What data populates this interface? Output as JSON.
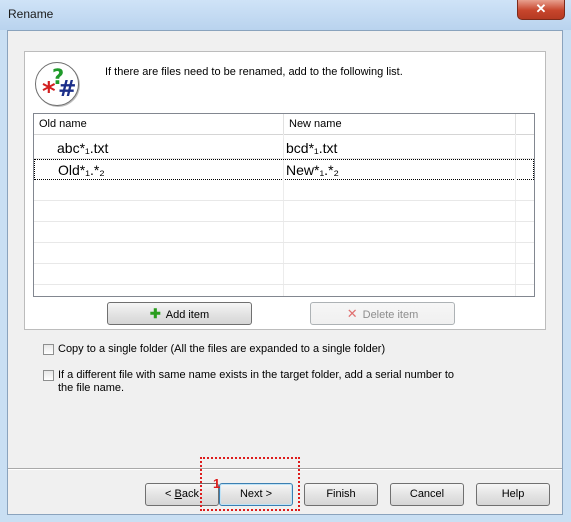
{
  "window": {
    "title": "Rename",
    "close_label": "✕"
  },
  "intro_text": "If there are files need to be renamed, add to the following list.",
  "list": {
    "columns": [
      "Old name",
      "New name"
    ],
    "rows": [
      {
        "old": "abc*₁.txt",
        "new": "bcd*₁.txt"
      },
      {
        "old": "Old*₁.*₂",
        "new": "New*₁.*₂"
      }
    ]
  },
  "buttons": {
    "add_item": "Add item",
    "delete_item": "Delete item",
    "back_prefix": "< ",
    "back_mnemonic": "B",
    "back_rest": "ack",
    "next": "Next >",
    "finish": "Finish",
    "cancel": "Cancel",
    "help": "Help"
  },
  "options": {
    "copy_single_folder": "Copy to a single folder (All the files are expanded to a single folder)",
    "serial_number_line1": "If a different file with same name exists in the target folder, add a serial number to",
    "serial_number_line2": "the file name."
  },
  "annotation": {
    "number": "1"
  },
  "colors": {
    "focus_box": "#dd1c1c",
    "titlebar": "#c9dff3",
    "close_button": "#c7452c"
  }
}
